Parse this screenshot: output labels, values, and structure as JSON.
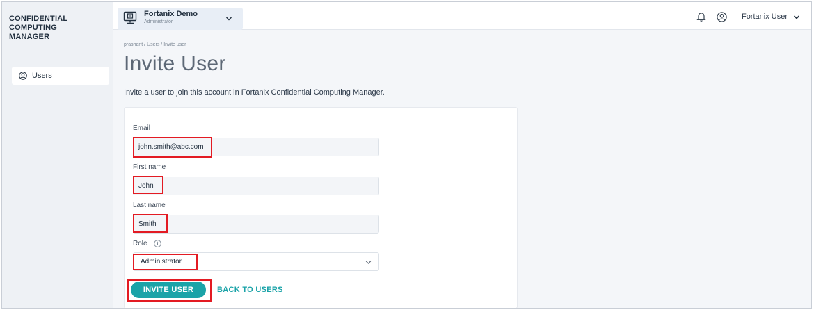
{
  "sidebar": {
    "brand_lines": [
      "CONFIDENTIAL",
      "COMPUTING",
      "MANAGER"
    ],
    "items": [
      {
        "label": "Users",
        "icon": "user-circle-icon"
      }
    ]
  },
  "topbar": {
    "account_name": "Fortanix Demo",
    "account_role": "Administrator",
    "user_name": "Fortanix User"
  },
  "breadcrumb": "prashant / Users / Invite user",
  "page": {
    "title": "Invite User",
    "description": "Invite a user to join this account in Fortanix Confidential Computing Manager."
  },
  "form": {
    "email_label": "Email",
    "email_value": "john.smith@abc.com",
    "first_name_label": "First name",
    "first_name_value": "John",
    "last_name_label": "Last name",
    "last_name_value": "Smith",
    "role_label": "Role",
    "role_value": "Administrator",
    "invite_button": "INVITE USER",
    "back_link": "BACK TO USERS"
  },
  "colors": {
    "accent": "#1aa3a8",
    "highlight": "#e31b23"
  }
}
